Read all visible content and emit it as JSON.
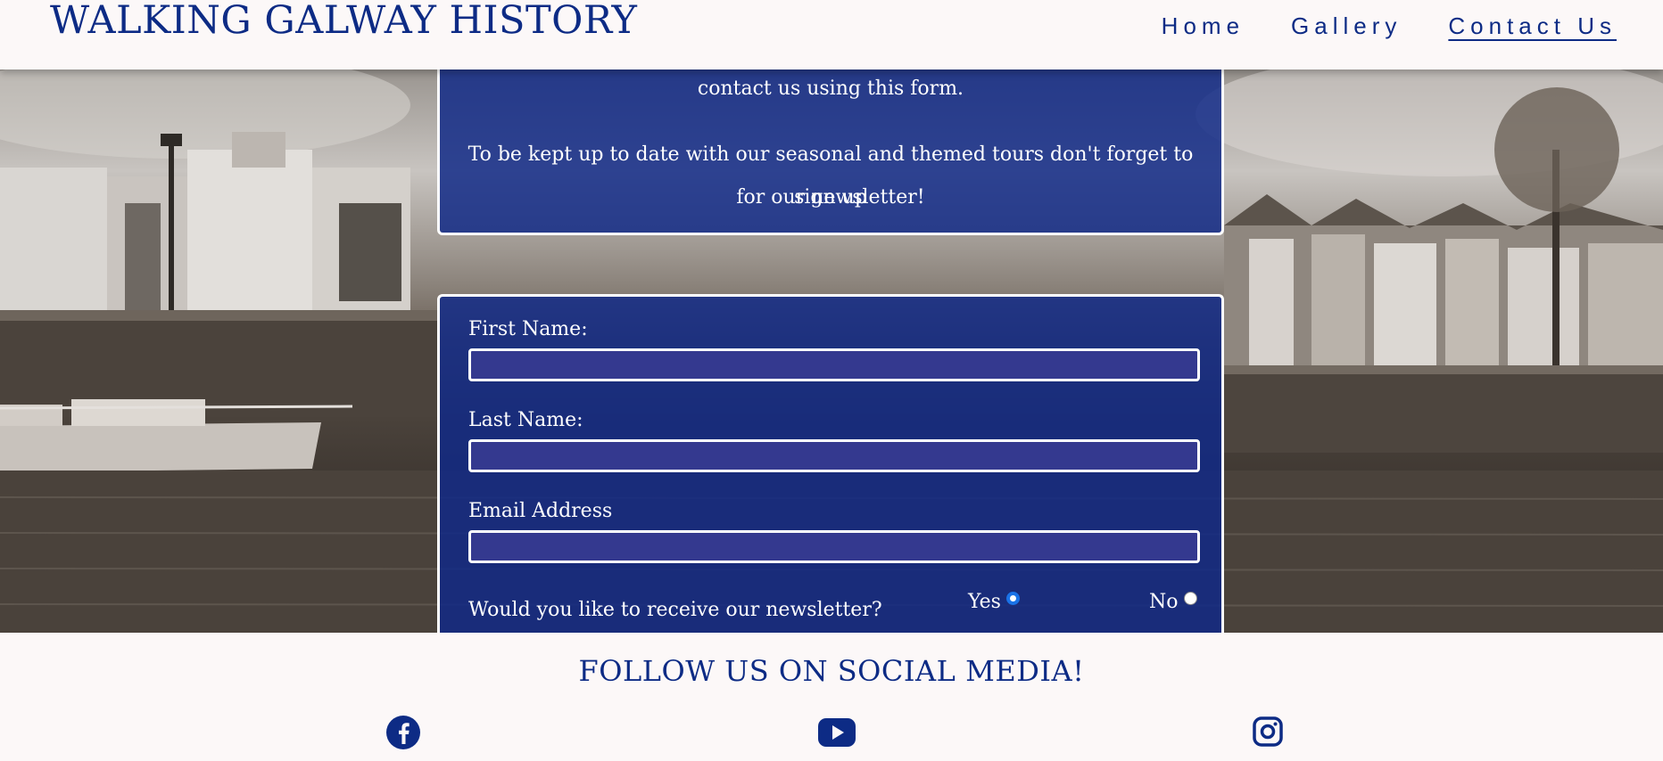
{
  "header": {
    "site_title": "WALKING GALWAY HISTORY",
    "nav": [
      {
        "label": "Home",
        "active": false
      },
      {
        "label": "Gallery",
        "active": false
      },
      {
        "label": "Contact Us",
        "active": true
      }
    ]
  },
  "intro": {
    "line1": "contact us using this form.",
    "line2": "To be kept up to date with our seasonal and themed tours don't forget to sign up",
    "line3": "for our newsletter!"
  },
  "form": {
    "first_name_label": "First Name:",
    "first_name_value": "",
    "last_name_label": "Last Name:",
    "last_name_value": "",
    "email_label": "Email Address",
    "email_value": "",
    "newsletter_question": "Would you like to receive our newsletter?",
    "option_yes": "Yes",
    "option_no": "No",
    "selected": "Yes"
  },
  "footer": {
    "follow_title": "FOLLOW US ON SOCIAL MEDIA!",
    "social_icons": [
      "facebook-icon",
      "youtube-icon",
      "instagram-icon"
    ]
  },
  "colors": {
    "brand_blue": "#0d2b85",
    "page_bg": "#fcf8f8",
    "panel_blue": "#0f2887",
    "input_fill": "#34398f",
    "radio_checked": "#1a73e8"
  }
}
